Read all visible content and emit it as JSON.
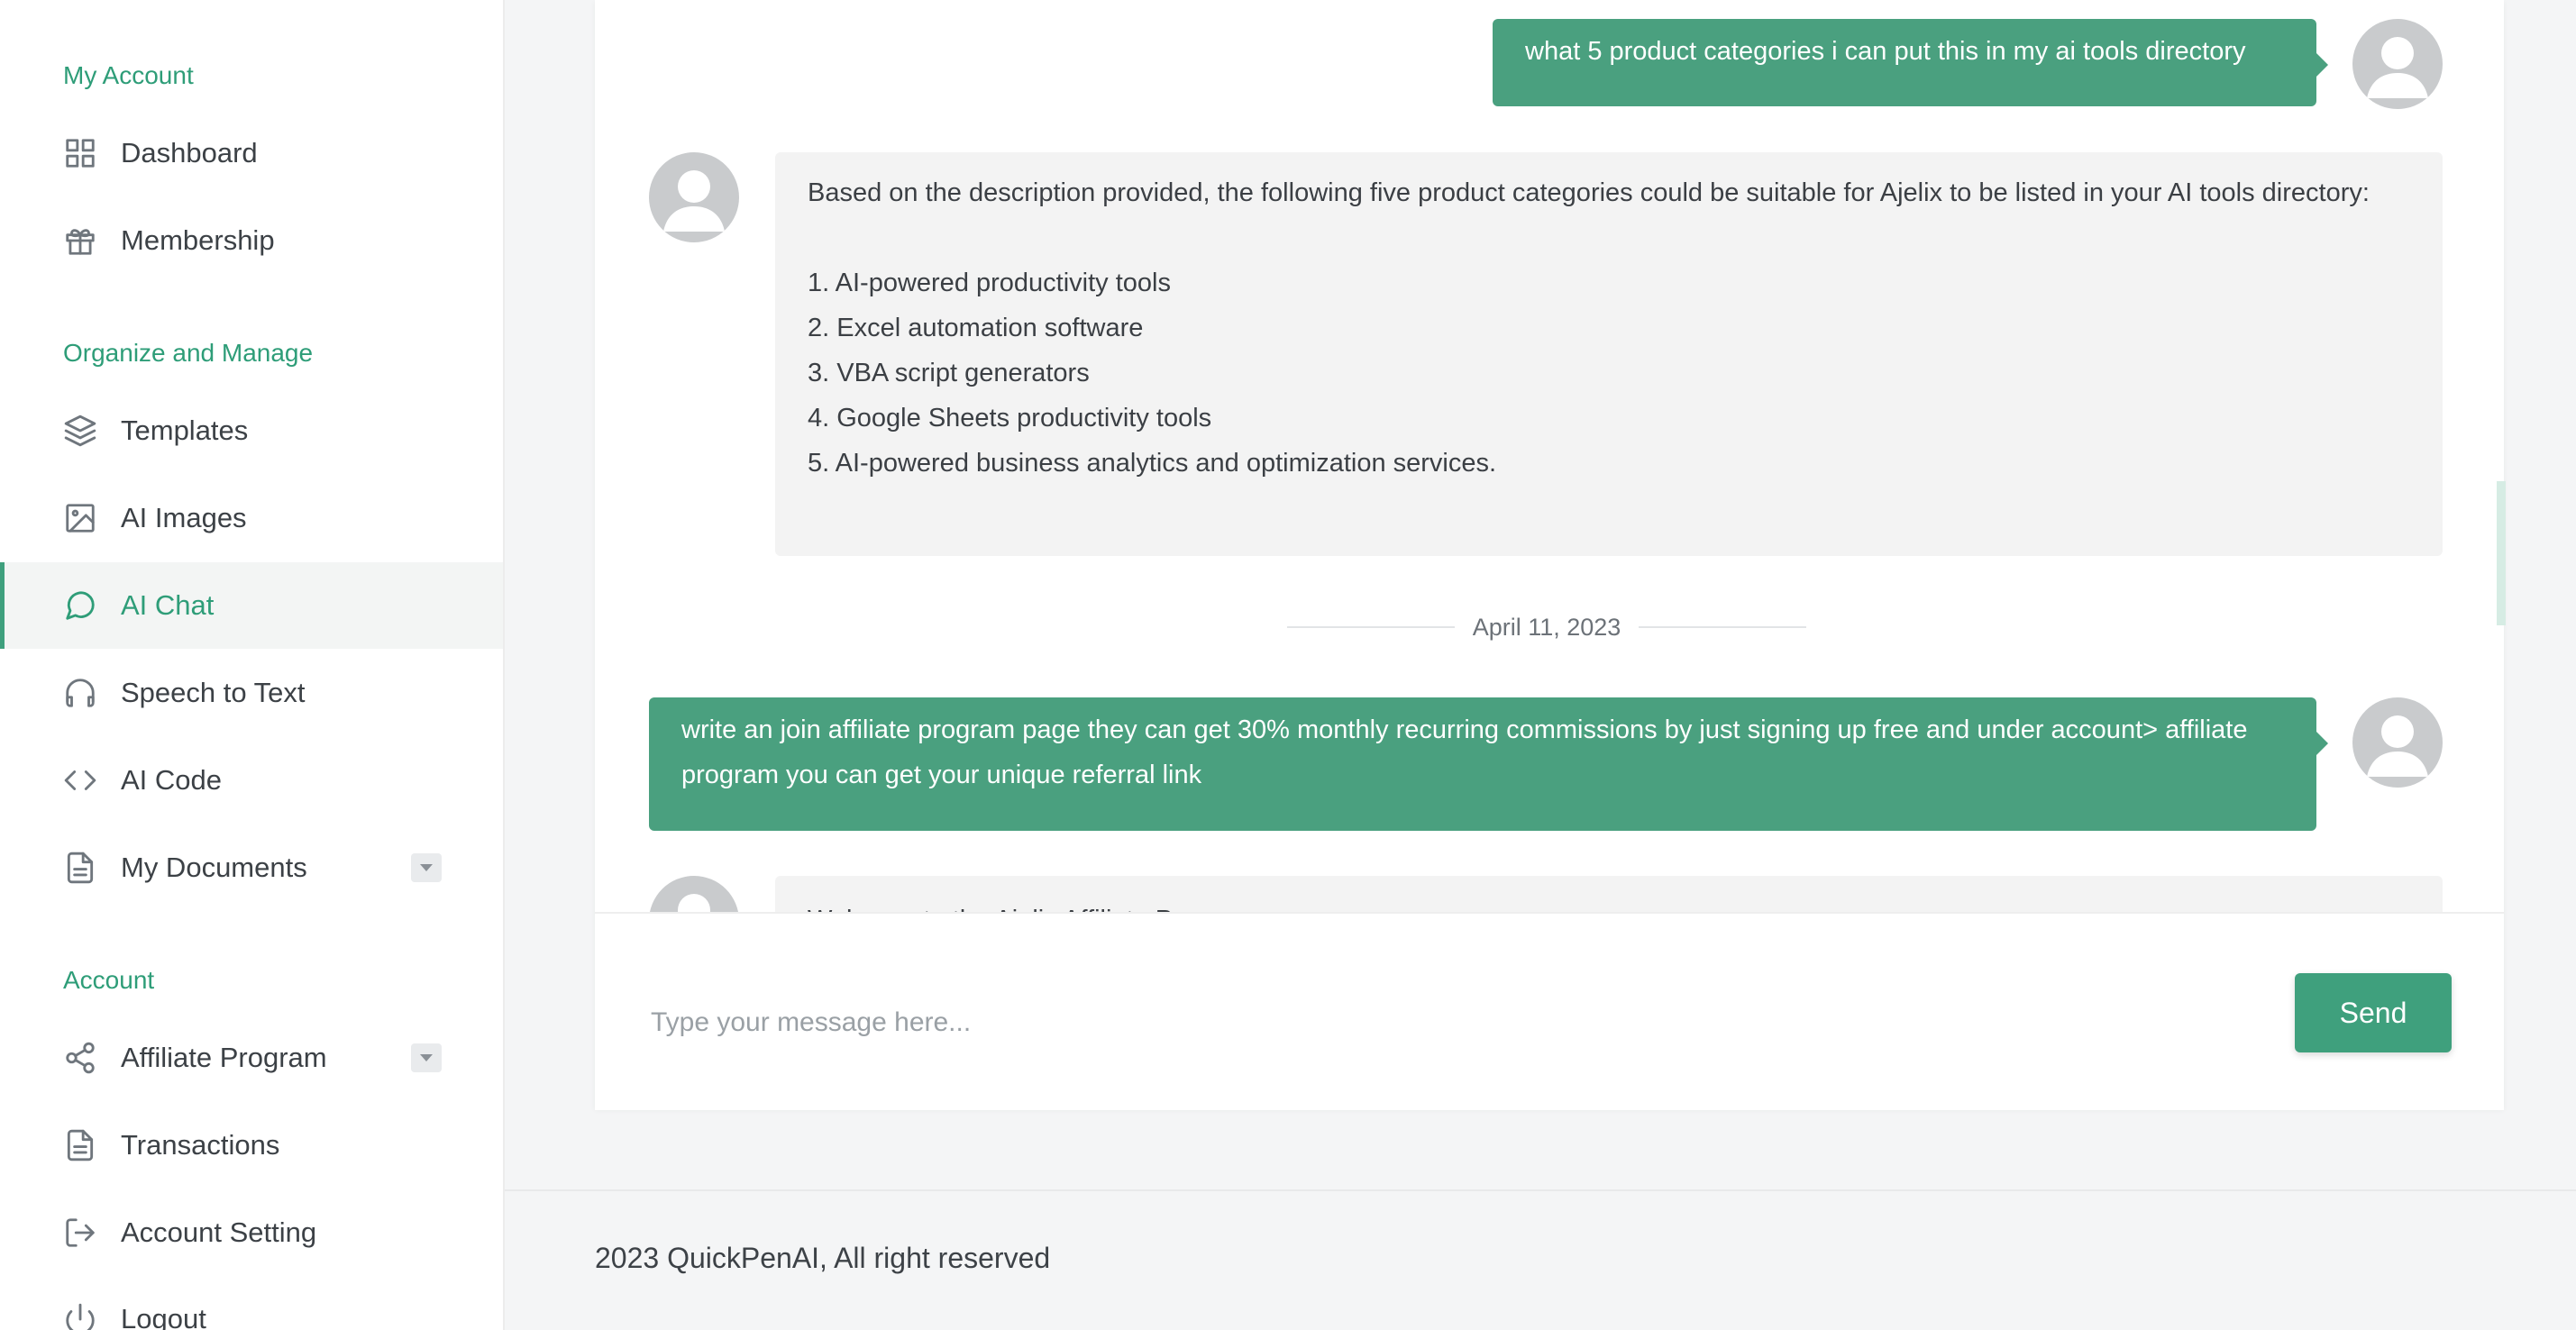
{
  "sidebar": {
    "sections": {
      "my_account": "My Account",
      "organize": "Organize and Manage",
      "account": "Account"
    },
    "items": [
      {
        "label": "Dashboard",
        "icon": "grid-icon"
      },
      {
        "label": "Membership",
        "icon": "gift-icon"
      },
      {
        "label": "Templates",
        "icon": "layers-icon"
      },
      {
        "label": "AI Images",
        "icon": "image-icon"
      },
      {
        "label": "AI Chat",
        "icon": "chat-bubble-icon",
        "active": true
      },
      {
        "label": "Speech to Text",
        "icon": "headphones-icon"
      },
      {
        "label": "AI Code",
        "icon": "code-icon"
      },
      {
        "label": "My Documents",
        "icon": "document-icon",
        "has_dropdown": true
      },
      {
        "label": "Affiliate Program",
        "icon": "share-icon",
        "has_dropdown": true
      },
      {
        "label": "Transactions",
        "icon": "file-icon"
      },
      {
        "label": "Account Setting",
        "icon": "log-out-icon"
      },
      {
        "label": "Logout",
        "icon": "power-icon"
      }
    ]
  },
  "chat": {
    "messages": [
      {
        "role": "user",
        "text": "what 5 product categories i can put this in my ai tools directory"
      },
      {
        "role": "assistant",
        "intro": "Based on the description provided, the following five product categories could be suitable for Ajelix to be listed in your AI tools directory:",
        "list": [
          "1. AI-powered productivity tools",
          "2. Excel automation software",
          "3. VBA script generators",
          "4. Google Sheets productivity tools",
          "5. AI-powered business analytics and optimization services."
        ]
      },
      {
        "role": "date",
        "text": "April 11, 2023"
      },
      {
        "role": "user",
        "text": "write an join affiliate program page they can get 30% monthly recurring commissions by just signing up free and under account> affiliate program you can get your unique referral link"
      },
      {
        "role": "assistant",
        "text": "Welcome to the Ajelix Affiliate Program"
      }
    ],
    "input": {
      "placeholder": "Type your message here...",
      "value": ""
    },
    "send_label": "Send"
  },
  "footer": {
    "text": "2023 QuickPenAI, All right reserved"
  },
  "colors": {
    "accent": "#3fa07d",
    "user_bubble": "#4aa07f",
    "bot_bubble": "#f3f3f3"
  }
}
